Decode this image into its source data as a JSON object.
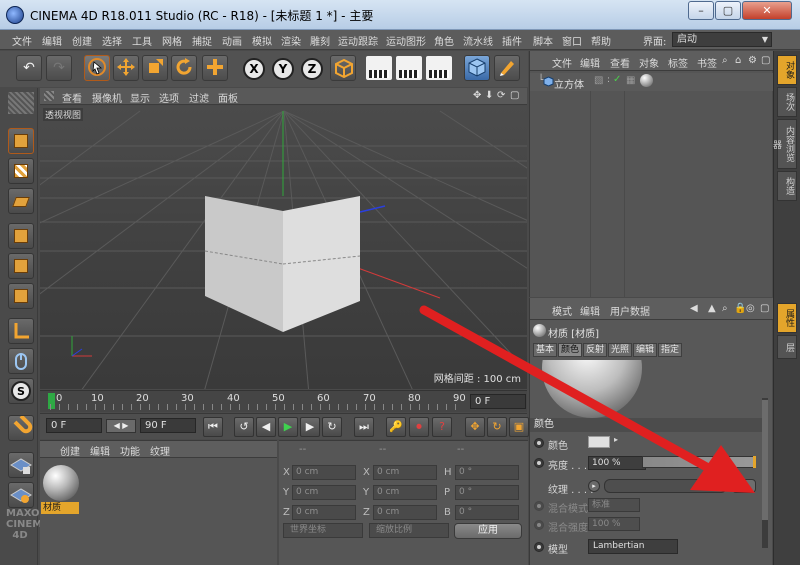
{
  "window": {
    "title": "CINEMA 4D R18.011 Studio (RC - R18) - [未标题 1 *] - 主要",
    "minimize": "–",
    "maximize": "▢",
    "close": "✕"
  },
  "menu": [
    "文件",
    "编辑",
    "创建",
    "选择",
    "工具",
    "网格",
    "捕捉",
    "动画",
    "模拟",
    "渲染",
    "雕刻",
    "运动跟踪",
    "运动图形",
    "角色",
    "流水线",
    "插件",
    "脚本",
    "窗口",
    "帮助"
  ],
  "layout": {
    "label": "界面:",
    "value": "启动"
  },
  "toolbar": {
    "undo": "↶",
    "redo": "↷",
    "axes": [
      "X",
      "Y",
      "Z"
    ]
  },
  "viewport": {
    "menu": [
      "查看",
      "摄像机",
      "显示",
      "选项",
      "过滤",
      "面板"
    ],
    "label": "透视视图",
    "grid_spacing": "网格间距 : 100 cm"
  },
  "timeline": {
    "ticks": [
      "0",
      "10",
      "20",
      "30",
      "40",
      "50",
      "60",
      "70",
      "80",
      "90"
    ],
    "current_frame": "0 F",
    "start_frame": "0 F",
    "end_frame": "90 F"
  },
  "material_manager": {
    "menu": [
      "创建",
      "编辑",
      "功能",
      "纹理"
    ],
    "material_name": "材质"
  },
  "coordinates": {
    "headers": [
      "--",
      "--",
      "--"
    ],
    "rows": [
      {
        "pos_axis": "X",
        "pos": "0 cm",
        "size_axis": "X",
        "size": "0 cm",
        "rot_axis": "H",
        "rot": "0 °"
      },
      {
        "pos_axis": "Y",
        "pos": "0 cm",
        "size_axis": "Y",
        "size": "0 cm",
        "rot_axis": "P",
        "rot": "0 °"
      },
      {
        "pos_axis": "Z",
        "pos": "0 cm",
        "size_axis": "Z",
        "size": "0 cm",
        "rot_axis": "B",
        "rot": "0 °"
      }
    ],
    "coord_system": "世界坐标",
    "scale_mode": "缩放比例",
    "apply": "应用"
  },
  "object_manager": {
    "menu": [
      "文件",
      "编辑",
      "查看",
      "对象",
      "标签",
      "书签"
    ],
    "objects": [
      {
        "name": "立方体"
      }
    ]
  },
  "attribute_manager": {
    "menu": [
      "模式",
      "编辑",
      "用户数据"
    ],
    "title": "材质 [材质]",
    "tabs": [
      "基本",
      "颜色",
      "反射",
      "光照",
      "编辑",
      "指定"
    ],
    "active_tab": "颜色",
    "section": "颜色",
    "rows": {
      "color_label": "颜色",
      "brightness_label": "亮度 . . .",
      "brightness_value": "100 %",
      "texture_label": "纹理 . . . .",
      "texture_button": "...",
      "mix_mode_label": "混合模式",
      "mix_mode_value": "标准",
      "mix_strength_label": "混合强度",
      "mix_strength_value": "100 %",
      "model_label": "模型",
      "model_value": "Lambertian"
    }
  },
  "side_tabs": {
    "top": [
      "对象",
      "场次",
      "内容浏览器",
      "构造"
    ],
    "bottom": [
      "属性",
      "层"
    ]
  },
  "colors": {
    "accent": "#e4a52b",
    "annotation": "#e02020",
    "active_tool_border": "#b05a1a"
  }
}
